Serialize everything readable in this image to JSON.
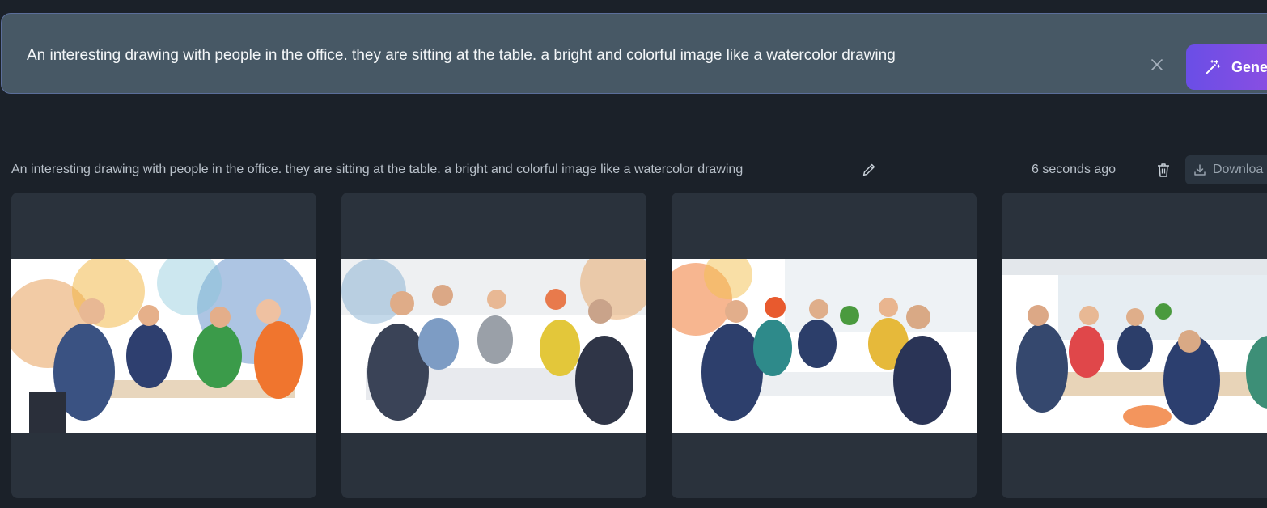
{
  "prompt_bar": {
    "value": "An interesting drawing with people in the office. they are sitting at the table. a bright and colorful image like a watercolor drawing",
    "generate_label": "Gene"
  },
  "result": {
    "prompt": "An interesting drawing with people in the office. they are sitting at the table. a bright and colorful image like a watercolor drawing",
    "time_ago": "6 seconds ago",
    "download_label": "Downloa"
  },
  "images": [
    {
      "alt": "Watercolor of four office workers in suits at a table with colorful splashes"
    },
    {
      "alt": "Watercolor of six colleagues working around a white table with papers"
    },
    {
      "alt": "Watercolor of a team meeting at a table near large windows with plants"
    },
    {
      "alt": "Watercolor of people in a bright office meeting room with windows"
    }
  ],
  "colors": {
    "background": "#1b2129",
    "bar": "#475865",
    "card": "#2a323c",
    "accent": "#7a4fe4"
  },
  "icons": {
    "clear": "close-icon",
    "generate": "magic-wand-icon",
    "edit": "pencil-icon",
    "delete": "trash-icon",
    "download": "download-icon"
  }
}
